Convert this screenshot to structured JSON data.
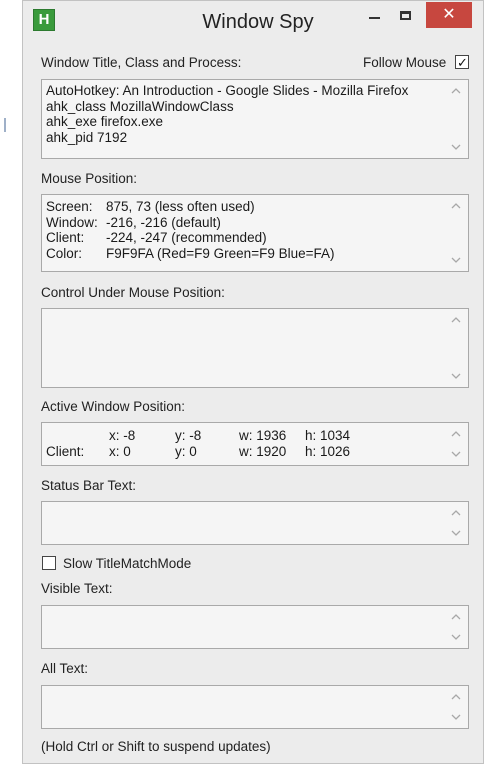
{
  "window": {
    "title": "Window Spy",
    "app_icon_letter": "H",
    "controls": {
      "minimize": "–",
      "maximize": "□",
      "close": "✕"
    }
  },
  "section_window": {
    "label": "Window Title, Class and Process:",
    "follow_mouse": {
      "label": "Follow Mouse",
      "checked": true,
      "check_glyph": "✓"
    },
    "lines": [
      "AutoHotkey: An Introduction - Google Slides - Mozilla Firefox",
      "ahk_class MozillaWindowClass",
      "ahk_exe firefox.exe",
      "ahk_pid 7192"
    ]
  },
  "section_mouse": {
    "label": "Mouse Position:",
    "rows": [
      {
        "key": "Screen:",
        "value": "875, 73 (less often used)"
      },
      {
        "key": "Window:",
        "value": "-216, -216 (default)"
      },
      {
        "key": "Client:",
        "value": "-224, -247 (recommended)"
      },
      {
        "key": "Color:",
        "value": "F9F9FA (Red=F9 Green=F9 Blue=FA)"
      }
    ]
  },
  "section_control": {
    "label": "Control Under Mouse Position:"
  },
  "section_active": {
    "label": "Active Window Position:",
    "rows": [
      {
        "name": "",
        "x": "x: -8",
        "y": "y: -8",
        "w": "w: 1936",
        "h": "h: 1034"
      },
      {
        "name": "Client:",
        "x": "x: 0",
        "y": "y: 0",
        "w": "w: 1920",
        "h": "h: 1026"
      }
    ]
  },
  "section_status": {
    "label": "Status Bar Text:"
  },
  "slow_title": {
    "label": "Slow TitleMatchMode",
    "checked": false
  },
  "section_visible": {
    "label": "Visible Text:"
  },
  "section_all": {
    "label": "All Text:"
  },
  "footer": {
    "hint": "(Hold Ctrl or Shift to suspend updates)"
  },
  "colors": {
    "close_button": "#c7473f",
    "app_icon": "#3a9b3c",
    "window_bg": "#ececec",
    "box_bg": "#f5f5f5"
  }
}
